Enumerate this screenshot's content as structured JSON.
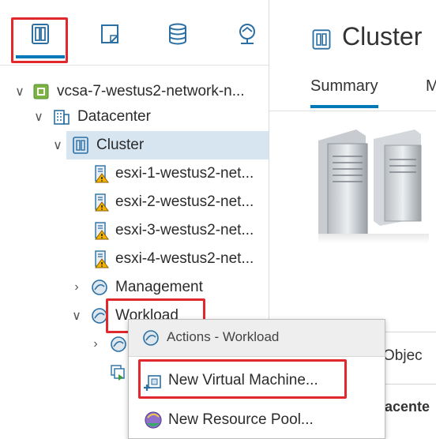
{
  "nav": {
    "tabs": [
      {
        "icon": "hosts-clusters-icon"
      },
      {
        "icon": "vms-templates-icon"
      },
      {
        "icon": "storage-icon"
      },
      {
        "icon": "networking-icon"
      }
    ],
    "tree": [
      {
        "label": "vcsa-7-westus2-network-n...",
        "icon": "vcenter-icon",
        "expanded": true
      },
      {
        "label": "Datacenter",
        "icon": "datacenter-icon",
        "expanded": true
      },
      {
        "label": "Cluster",
        "icon": "cluster-icon",
        "expanded": true,
        "selected": true
      },
      {
        "label": "esxi-1-westus2-net...",
        "icon": "host-warning-icon"
      },
      {
        "label": "esxi-2-westus2-net...",
        "icon": "host-warning-icon"
      },
      {
        "label": "esxi-3-westus2-net...",
        "icon": "host-warning-icon"
      },
      {
        "label": "esxi-4-westus2-net...",
        "icon": "host-warning-icon"
      },
      {
        "label": "Management",
        "icon": "resource-pool-icon",
        "expanded": false
      },
      {
        "label": "Workload",
        "icon": "resource-pool-icon",
        "expanded": true
      }
    ]
  },
  "content": {
    "title": "Cluster",
    "tabs": {
      "summary": "Summary",
      "next_partial": "M"
    },
    "objects_partial": "Objec",
    "datacenter_partial": "acente"
  },
  "context_menu": {
    "header": "Actions - Workload",
    "items": [
      {
        "label": "New Virtual Machine...",
        "icon": "new-vm-icon"
      },
      {
        "label": "New Resource Pool...",
        "icon": "new-resource-pool-icon"
      }
    ]
  },
  "colors": {
    "accent": "#0079b8",
    "highlight": "#e0282d",
    "selected_bg": "#d7e5f0",
    "warning": "#f5b301"
  }
}
